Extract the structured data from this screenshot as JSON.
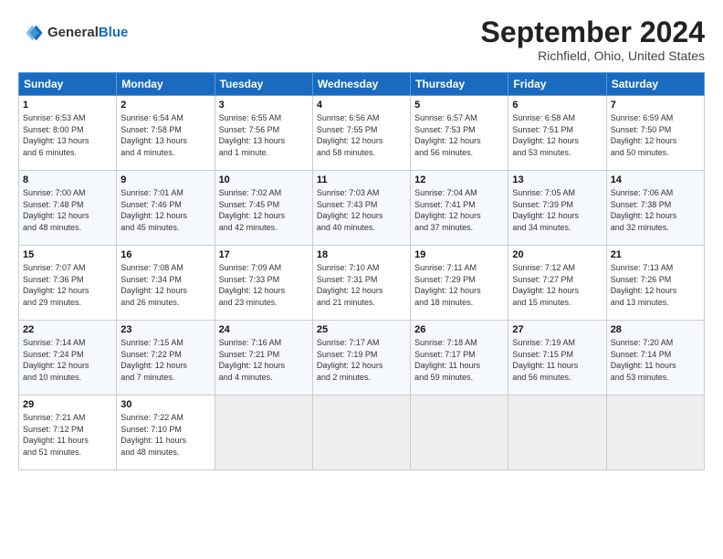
{
  "header": {
    "logo_general": "General",
    "logo_blue": "Blue",
    "month_title": "September 2024",
    "location": "Richfield, Ohio, United States"
  },
  "days_of_week": [
    "Sunday",
    "Monday",
    "Tuesday",
    "Wednesday",
    "Thursday",
    "Friday",
    "Saturday"
  ],
  "weeks": [
    [
      {
        "day": "1",
        "detail": "Sunrise: 6:53 AM\nSunset: 8:00 PM\nDaylight: 13 hours\nand 6 minutes."
      },
      {
        "day": "2",
        "detail": "Sunrise: 6:54 AM\nSunset: 7:58 PM\nDaylight: 13 hours\nand 4 minutes."
      },
      {
        "day": "3",
        "detail": "Sunrise: 6:55 AM\nSunset: 7:56 PM\nDaylight: 13 hours\nand 1 minute."
      },
      {
        "day": "4",
        "detail": "Sunrise: 6:56 AM\nSunset: 7:55 PM\nDaylight: 12 hours\nand 58 minutes."
      },
      {
        "day": "5",
        "detail": "Sunrise: 6:57 AM\nSunset: 7:53 PM\nDaylight: 12 hours\nand 56 minutes."
      },
      {
        "day": "6",
        "detail": "Sunrise: 6:58 AM\nSunset: 7:51 PM\nDaylight: 12 hours\nand 53 minutes."
      },
      {
        "day": "7",
        "detail": "Sunrise: 6:59 AM\nSunset: 7:50 PM\nDaylight: 12 hours\nand 50 minutes."
      }
    ],
    [
      {
        "day": "8",
        "detail": "Sunrise: 7:00 AM\nSunset: 7:48 PM\nDaylight: 12 hours\nand 48 minutes."
      },
      {
        "day": "9",
        "detail": "Sunrise: 7:01 AM\nSunset: 7:46 PM\nDaylight: 12 hours\nand 45 minutes."
      },
      {
        "day": "10",
        "detail": "Sunrise: 7:02 AM\nSunset: 7:45 PM\nDaylight: 12 hours\nand 42 minutes."
      },
      {
        "day": "11",
        "detail": "Sunrise: 7:03 AM\nSunset: 7:43 PM\nDaylight: 12 hours\nand 40 minutes."
      },
      {
        "day": "12",
        "detail": "Sunrise: 7:04 AM\nSunset: 7:41 PM\nDaylight: 12 hours\nand 37 minutes."
      },
      {
        "day": "13",
        "detail": "Sunrise: 7:05 AM\nSunset: 7:39 PM\nDaylight: 12 hours\nand 34 minutes."
      },
      {
        "day": "14",
        "detail": "Sunrise: 7:06 AM\nSunset: 7:38 PM\nDaylight: 12 hours\nand 32 minutes."
      }
    ],
    [
      {
        "day": "15",
        "detail": "Sunrise: 7:07 AM\nSunset: 7:36 PM\nDaylight: 12 hours\nand 29 minutes."
      },
      {
        "day": "16",
        "detail": "Sunrise: 7:08 AM\nSunset: 7:34 PM\nDaylight: 12 hours\nand 26 minutes."
      },
      {
        "day": "17",
        "detail": "Sunrise: 7:09 AM\nSunset: 7:33 PM\nDaylight: 12 hours\nand 23 minutes."
      },
      {
        "day": "18",
        "detail": "Sunrise: 7:10 AM\nSunset: 7:31 PM\nDaylight: 12 hours\nand 21 minutes."
      },
      {
        "day": "19",
        "detail": "Sunrise: 7:11 AM\nSunset: 7:29 PM\nDaylight: 12 hours\nand 18 minutes."
      },
      {
        "day": "20",
        "detail": "Sunrise: 7:12 AM\nSunset: 7:27 PM\nDaylight: 12 hours\nand 15 minutes."
      },
      {
        "day": "21",
        "detail": "Sunrise: 7:13 AM\nSunset: 7:26 PM\nDaylight: 12 hours\nand 13 minutes."
      }
    ],
    [
      {
        "day": "22",
        "detail": "Sunrise: 7:14 AM\nSunset: 7:24 PM\nDaylight: 12 hours\nand 10 minutes."
      },
      {
        "day": "23",
        "detail": "Sunrise: 7:15 AM\nSunset: 7:22 PM\nDaylight: 12 hours\nand 7 minutes."
      },
      {
        "day": "24",
        "detail": "Sunrise: 7:16 AM\nSunset: 7:21 PM\nDaylight: 12 hours\nand 4 minutes."
      },
      {
        "day": "25",
        "detail": "Sunrise: 7:17 AM\nSunset: 7:19 PM\nDaylight: 12 hours\nand 2 minutes."
      },
      {
        "day": "26",
        "detail": "Sunrise: 7:18 AM\nSunset: 7:17 PM\nDaylight: 11 hours\nand 59 minutes."
      },
      {
        "day": "27",
        "detail": "Sunrise: 7:19 AM\nSunset: 7:15 PM\nDaylight: 11 hours\nand 56 minutes."
      },
      {
        "day": "28",
        "detail": "Sunrise: 7:20 AM\nSunset: 7:14 PM\nDaylight: 11 hours\nand 53 minutes."
      }
    ],
    [
      {
        "day": "29",
        "detail": "Sunrise: 7:21 AM\nSunset: 7:12 PM\nDaylight: 11 hours\nand 51 minutes."
      },
      {
        "day": "30",
        "detail": "Sunrise: 7:22 AM\nSunset: 7:10 PM\nDaylight: 11 hours\nand 48 minutes."
      },
      {
        "day": "",
        "detail": ""
      },
      {
        "day": "",
        "detail": ""
      },
      {
        "day": "",
        "detail": ""
      },
      {
        "day": "",
        "detail": ""
      },
      {
        "day": "",
        "detail": ""
      }
    ]
  ]
}
